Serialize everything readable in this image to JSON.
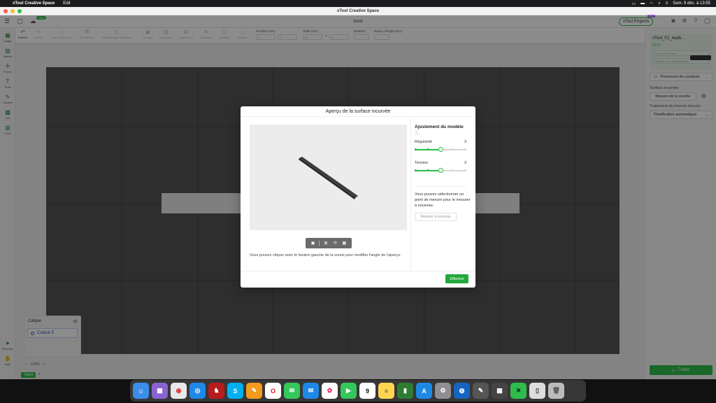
{
  "menubar": {
    "app_name": "xTool Creative Space",
    "menu_edit": "Edit",
    "datetime": "Sam. 9 déc. à 13:55"
  },
  "window": {
    "title": "xTool Creative Space"
  },
  "appbar": {
    "new_badge": "New",
    "doc_title": "book",
    "projects_label": "xTool Projects",
    "projects_badge": "Beta"
  },
  "toolbar": {
    "undo": "Enlever",
    "redo": "Refaire",
    "outline": "Ligne extérieure",
    "offset": "Décalement",
    "smart_fill": "Remplissage intelligent",
    "group": "Grouper",
    "ungroup": "Dégrouper",
    "align": "Alignement",
    "arrange": "Organiser",
    "combine": "Combiner",
    "mirror": "Refléter",
    "position_label": "Position (mm)",
    "size_label": "Taille (mm)",
    "rotation_label": "Rotation",
    "radius_label": "Rayon d'angle (mm)",
    "x_ph": "X",
    "y_ph": "Y",
    "w_ph": "W",
    "h_ph": "H"
  },
  "leftbar": {
    "items": [
      "Image",
      "Insérer",
      "Forme",
      "Texte",
      "Vecteur",
      "xArt",
      "Code"
    ],
    "bottom": [
      "Sélection",
      "Main"
    ]
  },
  "layers": {
    "title": "Calque",
    "items": [
      "Calque 5"
    ]
  },
  "zoom": {
    "minus": "−",
    "value": "410%",
    "plus": "+"
  },
  "tabs": {
    "active": "Tablet",
    "add": "+"
  },
  "rightpanel": {
    "device_name": "xTool_F2_4adb...",
    "wifi": "Wi-Fi",
    "field1": "Tout actionnement",
    "field2": "Capturer une vue intérieure",
    "process": "Processus de courbure",
    "surface_label": "Surface incurvée",
    "measure_btn": "Mesure de la courbe",
    "path_label": "Traitement du chemin d'accès",
    "path_value": "Planification automatique",
    "traiter": "Traiter"
  },
  "modal": {
    "title": "Aperçu de la surface incurvée",
    "hint": "Vous pouvez cliquer avec le bouton gauche de la souris pour modifier l'angle de l'aperçu.",
    "adjust_title": "Ajustement du modèle",
    "info_icon": "ⓘ",
    "regularity_label": "Régularité",
    "regularity_value": "3",
    "regularity_level": 0.5,
    "tension_label": "Tension",
    "tension_value": "3",
    "tension_level": 0.5,
    "measure_text": "Vous pouvez sélectionner un point de mesure pour le mesurer à nouveau.",
    "remeasure_btn": "Mesurer à nouveau",
    "done_btn": "Effectué"
  },
  "colors": {
    "accent": "#2ebd4c",
    "canvas": "#555555",
    "overlay": "rgba(0,0,0,0.45)"
  }
}
